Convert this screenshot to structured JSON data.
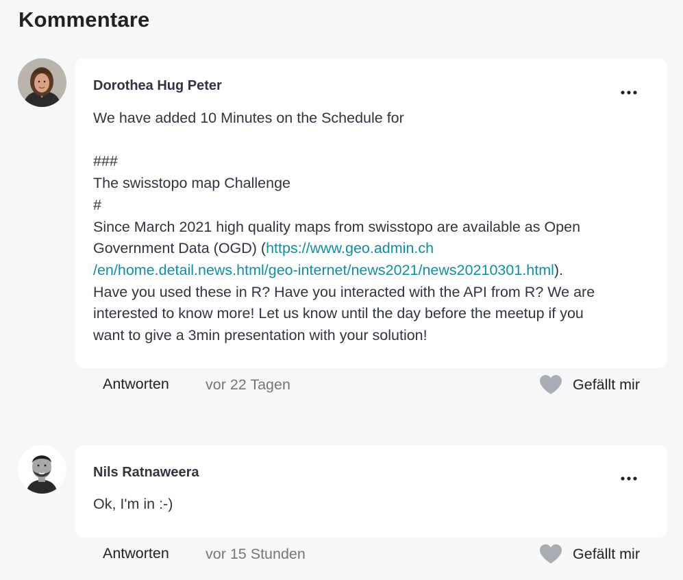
{
  "section": {
    "title": "Kommentare"
  },
  "colors": {
    "link": "#0d8ea3",
    "heart": "#a8adb3",
    "background": "#f6f7f8",
    "card": "#ffffff"
  },
  "comments": [
    {
      "author": "Dorothea Hug Peter",
      "avatar_icon": "avatar-photo-woman",
      "more_icon": "more-dots-icon",
      "lines": [
        "We have added 10 Minutes on the Schedule for",
        "",
        "###",
        "The swisstopo map Challenge",
        "#",
        "Since March 2021 high quality maps from swisstopo are available as Open",
        "Government Data (OGD) ("
      ],
      "link_text_1": "https://www.geo.admin.ch",
      "link_text_2": "/en/home.detail.news.html/geo-internet/news2021/news20210301.html",
      "after_link": ").",
      "closing_lines": [
        "Have you used these in R? Have you interacted with the API from R? We are",
        "interested to know more! Let us know until the day before the meetup if you",
        "want to give a 3min presentation with your solution!"
      ],
      "reply_label": "Antworten",
      "timestamp": "vor 22 Tagen",
      "like_label": "Gefällt mir"
    },
    {
      "author": "Nils Ratnaweera",
      "avatar_icon": "avatar-photo-man",
      "more_icon": "more-dots-icon",
      "text": "Ok, I'm in :-)",
      "reply_label": "Antworten",
      "timestamp": "vor 15 Stunden",
      "like_label": "Gefällt mir"
    }
  ]
}
